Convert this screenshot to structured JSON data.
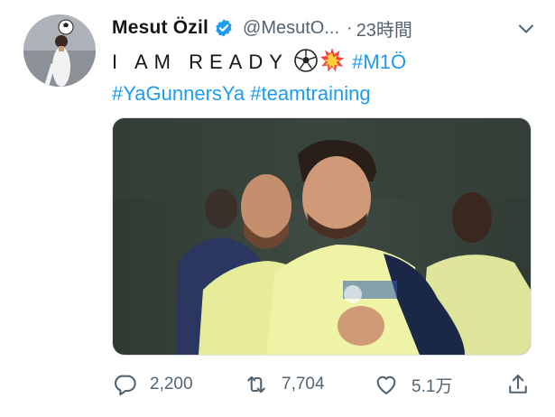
{
  "tweet": {
    "author_name": "Mesut Özil",
    "handle": "@MesutO...",
    "separator": "·",
    "time": "23時間",
    "text_main": "I AM READY",
    "hashtag_1": "#M1Ö",
    "hashtag_2": "#YaGunnersYa",
    "hashtag_3": "#teamtraining"
  },
  "actions": {
    "replies": "2,200",
    "retweets": "7,704",
    "likes": "5.1万"
  },
  "colors": {
    "link": "#1d9bf0",
    "verified": "#1d9bf0",
    "muted": "#536471"
  },
  "icons": [
    "verified-badge-icon",
    "caret-down-icon",
    "soccer-ball-emoji",
    "collision-emoji",
    "reply-icon",
    "retweet-icon",
    "like-icon",
    "share-icon"
  ]
}
